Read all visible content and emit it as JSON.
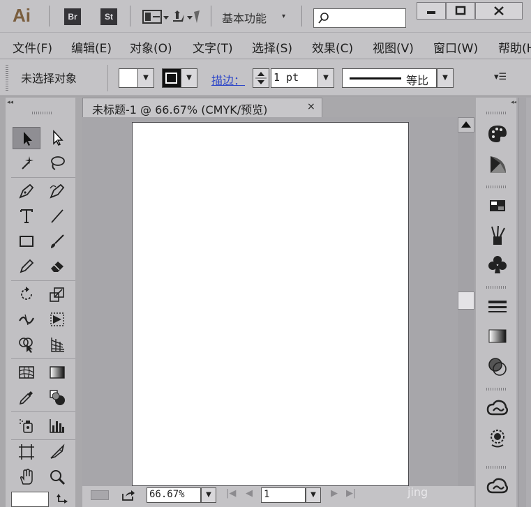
{
  "app": {
    "logo": "Ai",
    "bridge": "Br",
    "stock": "St"
  },
  "workspace": {
    "label": "基本功能",
    "arrow": "▾"
  },
  "search": {
    "icon": "search-icon",
    "placeholder": ""
  },
  "window_buttons": {
    "minimize": "▬",
    "maximize": "▢",
    "close": "✕"
  },
  "menu": [
    "文件(F)",
    "编辑(E)",
    "对象(O)",
    "文字(T)",
    "选择(S)",
    "效果(C)",
    "视图(V)",
    "窗口(W)",
    "帮助(H)"
  ],
  "control": {
    "selection_status": "未选择对象",
    "stroke_label": "描边：",
    "stroke_weight": "1 pt",
    "stroke_profile": "等比",
    "panel_menu": "▾☰"
  },
  "document": {
    "tab_title": "未标题-1 @ 66.67% (CMYK/预览)",
    "close": "×"
  },
  "status": {
    "zoom": "66.67%",
    "page": "1",
    "watermark": "jing"
  },
  "colors": {
    "chrome": "#c4c3c6",
    "canvas": "#a7a6aa",
    "artboard": "#ffffff",
    "link": "#2b45c8",
    "logo": "#7a5e3e"
  }
}
